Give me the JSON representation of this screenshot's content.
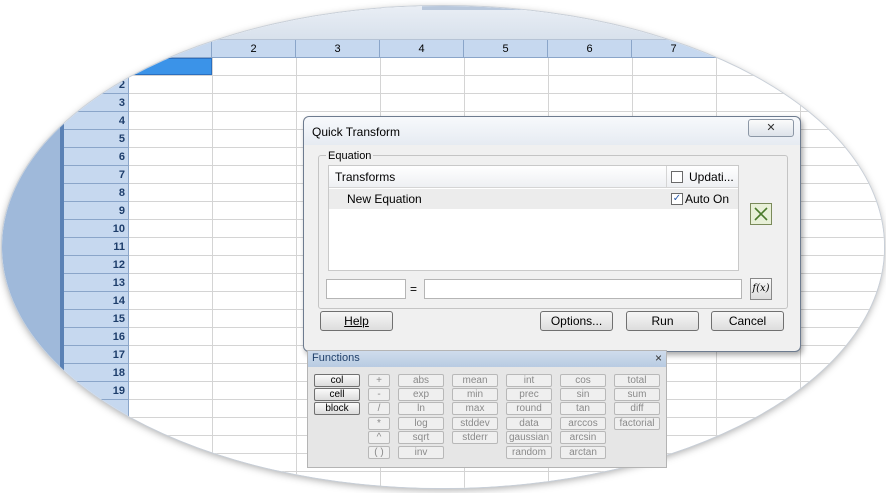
{
  "spreadsheet": {
    "column_headers": [
      "2",
      "3",
      "4",
      "5",
      "6",
      "7"
    ],
    "row_headers": [
      "2",
      "3",
      "4",
      "5",
      "6",
      "7",
      "8",
      "9",
      "10",
      "11",
      "12",
      "13",
      "14",
      "15",
      "16",
      "17",
      "18",
      "19"
    ]
  },
  "dialog": {
    "title": "Quick Transform",
    "group_label": "Equation",
    "list_header_transforms": "Transforms",
    "list_header_update": "Updati...",
    "row_label": "New Equation",
    "row_check_mark": "✓",
    "row_auto": "Auto On",
    "close_glyph": "✕",
    "equals": "=",
    "fx_label": "f(x)",
    "left_field_value": "",
    "right_field_value": "",
    "buttons": {
      "help": "Help",
      "options": "Options...",
      "run": "Run",
      "cancel": "Cancel"
    }
  },
  "functions": {
    "title": "Functions",
    "close_glyph": "×",
    "col0": [
      "col",
      "cell",
      "block"
    ],
    "col1": [
      "+",
      "-",
      "/",
      "*",
      "^",
      "( )"
    ],
    "col2": [
      "abs",
      "exp",
      "ln",
      "log",
      "sqrt",
      "inv"
    ],
    "col3": [
      "mean",
      "min",
      "max",
      "stddev",
      "stderr"
    ],
    "col4": [
      "int",
      "prec",
      "round",
      "data",
      "gaussian",
      "random"
    ],
    "col5": [
      "cos",
      "sin",
      "tan",
      "arccos",
      "arcsin",
      "arctan"
    ],
    "col6": [
      "total",
      "sum",
      "diff",
      "factorial"
    ]
  }
}
